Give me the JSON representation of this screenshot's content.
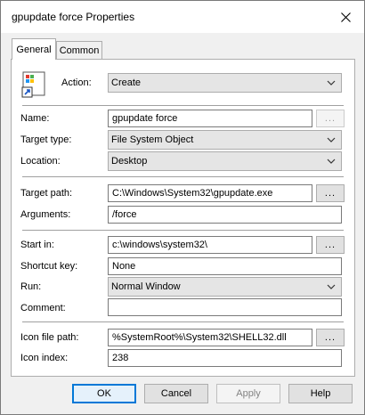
{
  "window": {
    "title": "gpupdate force Properties"
  },
  "tabs": [
    {
      "label": "General",
      "active": true
    },
    {
      "label": "Common",
      "active": false
    }
  ],
  "general": {
    "action": {
      "label": "Action:",
      "value": "Create"
    },
    "name": {
      "label": "Name:",
      "value": "gpupdate force",
      "browse_label": "..."
    },
    "target_type": {
      "label": "Target type:",
      "value": "File System Object"
    },
    "location": {
      "label": "Location:",
      "value": "Desktop"
    },
    "target_path": {
      "label": "Target path:",
      "value": "C:\\Windows\\System32\\gpupdate.exe",
      "browse_label": "..."
    },
    "arguments": {
      "label": "Arguments:",
      "value": "/force"
    },
    "start_in": {
      "label": "Start in:",
      "value": "c:\\windows\\system32\\",
      "browse_label": "..."
    },
    "shortcut_key": {
      "label": "Shortcut key:",
      "value": "None"
    },
    "run": {
      "label": "Run:",
      "value": "Normal Window"
    },
    "comment": {
      "label": "Comment:",
      "value": ""
    },
    "icon_file_path": {
      "label": "Icon file path:",
      "value": "%SystemRoot%\\System32\\SHELL32.dll",
      "browse_label": "..."
    },
    "icon_index": {
      "label": "Icon index:",
      "value": "238"
    }
  },
  "buttons": {
    "ok": "OK",
    "cancel": "Cancel",
    "apply": "Apply",
    "help": "Help"
  },
  "colors": {
    "accent": "#0078d7",
    "dialog_bg": "#f0f0f0",
    "panel_bg": "#ffffff"
  },
  "icons": {
    "close": "close-icon",
    "action": "shortcut-create-icon",
    "dropdown": "chevron-down-icon"
  }
}
